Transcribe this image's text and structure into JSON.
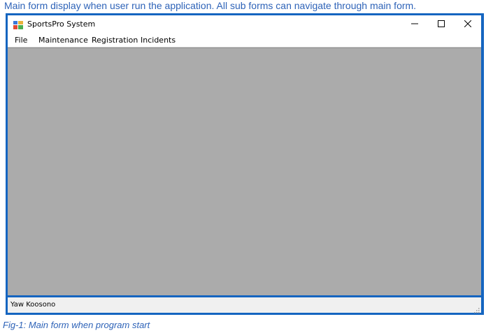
{
  "page": {
    "top_caption": "Main form display when user run the application. All sub forms can navigate through main form.",
    "bottom_caption": "Fig-1: Main form when program start"
  },
  "window": {
    "title": "SportsPro System",
    "icon": "app-icon",
    "controls": {
      "minimize_icon": "minimize-icon",
      "maximize_icon": "maximize-icon",
      "close_icon": "close-icon"
    }
  },
  "menu": {
    "items": [
      {
        "label": "File"
      },
      {
        "label": "Maintenance"
      },
      {
        "label": "Registration"
      },
      {
        "label": "Incidents"
      }
    ]
  },
  "statusbar": {
    "label": "Yaw Koosono"
  },
  "colors": {
    "window_border": "#1565c0",
    "mdi_background": "#ababab",
    "caption_text": "#2e63b8"
  }
}
